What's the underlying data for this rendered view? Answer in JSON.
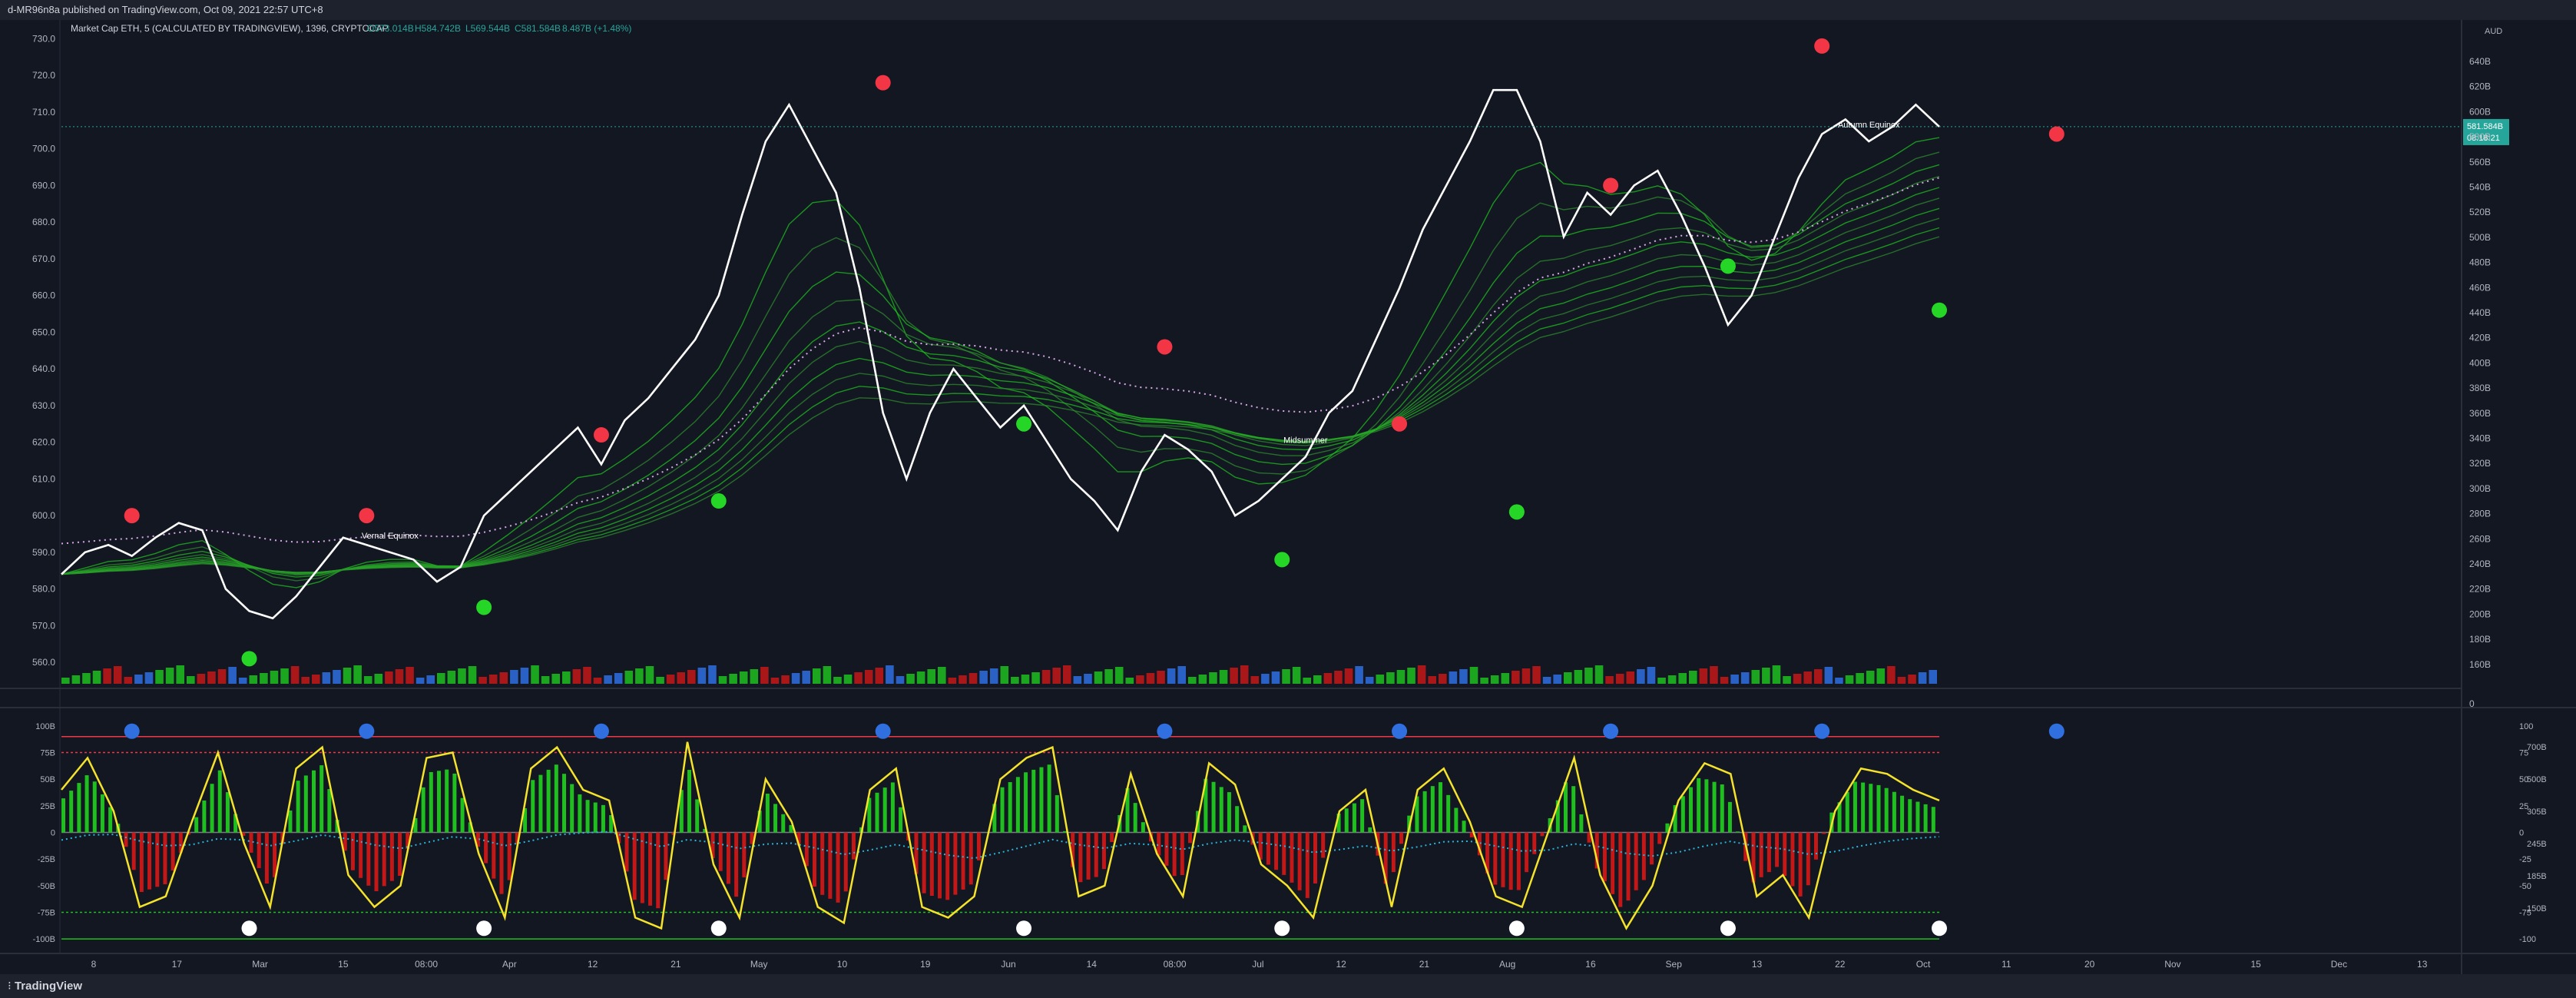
{
  "header": {
    "published": "d-MR96n8a published on TradingView.com, Oct 09, 2021 22:57 UTC+8"
  },
  "legend": {
    "symbol": "Market Cap ETH, 5 (CALCULATED BY TRADINGVIEW), 1396, CRYPTOCAP",
    "o": "O573.014B",
    "h": "H584.742B",
    "l": "L569.544B",
    "c": "C581.584B",
    "chg": "8.487B (+1.48%)"
  },
  "footer": {
    "brand": "TradingView"
  },
  "colors": {
    "background": "#131722",
    "price_line": "#ffffff",
    "bull": "#1fbf1f",
    "bear": "#c41717",
    "stoch": "#f5e32a",
    "signal": "#27b5d9",
    "dot_red": "#f23645",
    "dot_green": "#26d626",
    "dot_blue": "#2f6fe0",
    "dot_white": "#ffffff",
    "price_badge": "#26a69a"
  },
  "chart_data": [
    {
      "type": "line",
      "name": "price",
      "left_axis": [
        "730.0",
        "720.0",
        "710.0",
        "700.0",
        "690.0",
        "680.0",
        "670.0",
        "660.0",
        "650.0",
        "640.0",
        "630.0",
        "620.0",
        "610.0",
        "600.0",
        "590.0",
        "580.0",
        "570.0",
        "560.0"
      ],
      "right_axis": [
        "640B",
        "620B",
        "600B",
        "580B",
        "560B",
        "540B",
        "520B",
        "500B",
        "480B",
        "460B",
        "440B",
        "420B",
        "400B",
        "380B",
        "360B",
        "340B",
        "320B",
        "300B",
        "280B",
        "260B",
        "240B",
        "220B",
        "200B",
        "180B",
        "160B",
        "0"
      ],
      "right_axis_unit": "AUD",
      "last_price": "581.584B",
      "countdown": "08:18:21",
      "ylim": [
        555,
        733
      ],
      "x_ticks": [
        "8",
        "17",
        "Mar",
        "15",
        "08:00",
        "Apr",
        "12",
        "21",
        "May",
        "10",
        "19",
        "Jun",
        "14",
        "08:00",
        "Jul",
        "12",
        "21",
        "Aug",
        "16",
        "Sep",
        "13",
        "22",
        "Oct",
        "11",
        "20",
        "Nov",
        "15",
        "Dec",
        "13"
      ],
      "values": [
        584,
        590,
        592,
        589,
        594,
        598,
        596,
        580,
        574,
        572,
        578,
        586,
        594,
        592,
        590,
        588,
        582,
        586,
        600,
        606,
        612,
        618,
        624,
        614,
        626,
        632,
        640,
        648,
        660,
        682,
        702,
        712,
        700,
        688,
        662,
        628,
        610,
        628,
        640,
        632,
        624,
        630,
        620,
        610,
        604,
        596,
        612,
        622,
        618,
        612,
        600,
        604,
        610,
        616,
        628,
        634,
        648,
        662,
        678,
        690,
        702,
        716,
        716,
        702,
        676,
        688,
        682,
        690,
        694,
        682,
        668,
        652,
        660,
        676,
        692,
        704,
        708,
        702,
        706,
        712,
        706
      ],
      "annotations": [
        "Vernal Equinox",
        "Midsummer",
        "Autumn Equinox"
      ],
      "dots": [
        {
          "color": "red",
          "x": 3,
          "y": 600
        },
        {
          "color": "green",
          "x": 8,
          "y": 561
        },
        {
          "color": "red",
          "x": 13,
          "y": 600
        },
        {
          "color": "green",
          "x": 18,
          "y": 575
        },
        {
          "color": "red",
          "x": 23,
          "y": 622
        },
        {
          "color": "green",
          "x": 28,
          "y": 604
        },
        {
          "color": "red",
          "x": 35,
          "y": 718
        },
        {
          "color": "green",
          "x": 41,
          "y": 625
        },
        {
          "color": "red",
          "x": 47,
          "y": 646
        },
        {
          "color": "green",
          "x": 52,
          "y": 588
        },
        {
          "color": "red",
          "x": 57,
          "y": 625
        },
        {
          "color": "green",
          "x": 62,
          "y": 601
        },
        {
          "color": "red",
          "x": 66,
          "y": 690
        },
        {
          "color": "green",
          "x": 71,
          "y": 668
        },
        {
          "color": "red",
          "x": 75,
          "y": 728
        },
        {
          "color": "green",
          "x": 80,
          "y": 656
        },
        {
          "color": "red",
          "x": 85,
          "y": 704
        }
      ]
    },
    {
      "type": "line",
      "name": "oscillator",
      "left_axis": [
        "100B",
        "75B",
        "50B",
        "25B",
        "0",
        "-25B",
        "-50B",
        "-75B",
        "-100B"
      ],
      "right_axis": [
        "100",
        "75",
        "50",
        "25",
        "0",
        "-25",
        "-50",
        "-75",
        "-100"
      ],
      "right_axis2": [
        "700B",
        "500B",
        "305B",
        "245B",
        "185B",
        "150B"
      ],
      "ylim": [
        -110,
        110
      ],
      "values": [
        40,
        70,
        20,
        -70,
        -60,
        10,
        75,
        -10,
        -70,
        60,
        80,
        -40,
        -70,
        -50,
        70,
        75,
        -20,
        -80,
        60,
        80,
        40,
        30,
        -80,
        -90,
        85,
        -30,
        -80,
        50,
        10,
        -70,
        -85,
        40,
        60,
        -70,
        -80,
        -60,
        50,
        70,
        80,
        -60,
        -50,
        55,
        -20,
        -60,
        65,
        45,
        -30,
        -50,
        -80,
        20,
        40,
        -70,
        40,
        60,
        10,
        -60,
        -70,
        0,
        70,
        -40,
        -90,
        -50,
        30,
        65,
        55,
        -60,
        -40,
        -80,
        20,
        60,
        55,
        40,
        30
      ]
    }
  ]
}
